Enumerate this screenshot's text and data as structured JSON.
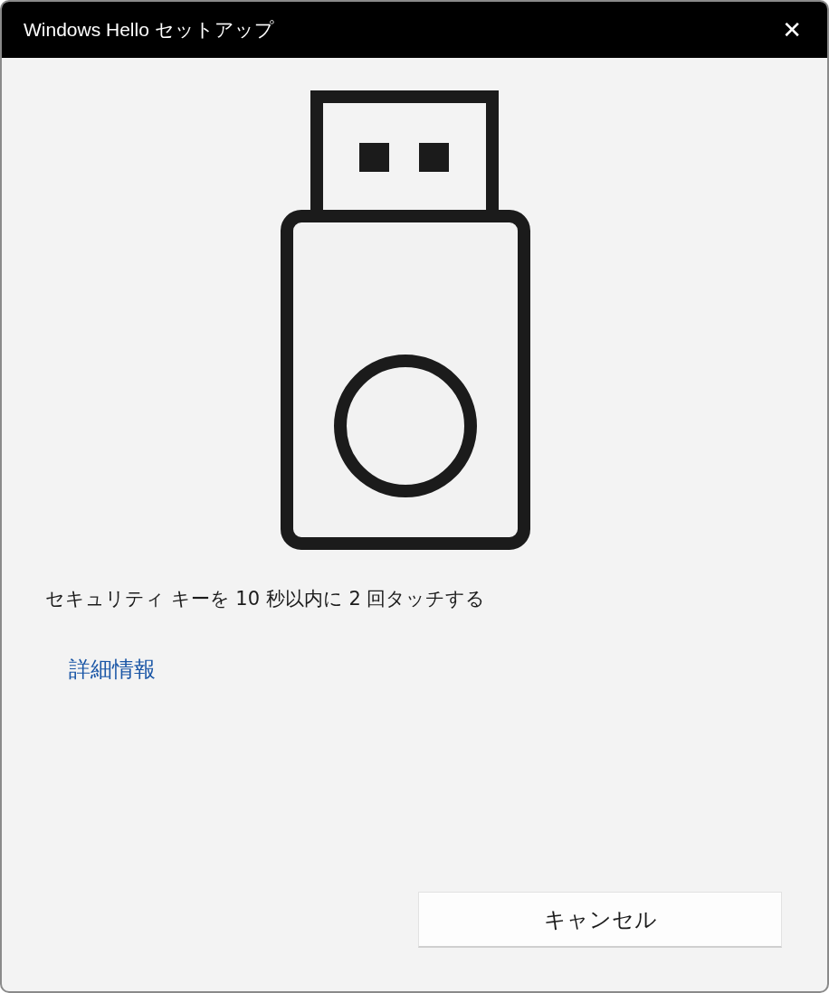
{
  "window": {
    "title": "Windows Hello セットアップ",
    "close_glyph": "✕"
  },
  "instruction": "セキュリティ キーを 10 秒以内に 2 回タッチする",
  "link": "詳細情報",
  "buttons": [
    {
      "label": "キャンセル"
    }
  ]
}
